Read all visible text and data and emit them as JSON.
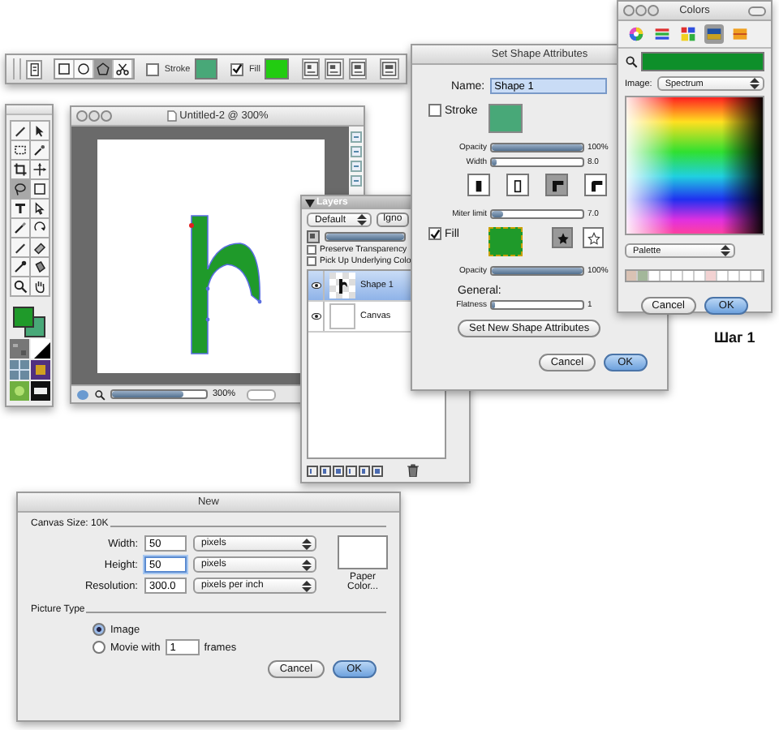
{
  "toolbar": {
    "tools": [
      {
        "kind": "rect",
        "selected": false
      },
      {
        "kind": "ellipse",
        "selected": false
      },
      {
        "kind": "polygon",
        "selected": true
      },
      {
        "kind": "scissors",
        "selected": false
      }
    ],
    "stroke": {
      "label": "Stroke",
      "checked": false
    },
    "fill": {
      "label": "Fill",
      "checked": true
    }
  },
  "tools_palette": {
    "tools": [
      {
        "kind": "pencil",
        "selected": false
      },
      {
        "kind": "arrow",
        "selected": false
      },
      {
        "kind": "marquee",
        "selected": false
      },
      {
        "kind": "wand",
        "selected": false
      },
      {
        "kind": "crop",
        "selected": false
      },
      {
        "kind": "move",
        "selected": false
      },
      {
        "kind": "lasso",
        "selected": true
      },
      {
        "kind": "rect",
        "selected": false
      },
      {
        "kind": "text",
        "selected": false
      },
      {
        "kind": "pointer",
        "selected": false
      },
      {
        "kind": "brush",
        "selected": false
      },
      {
        "kind": "rotate",
        "selected": false
      },
      {
        "kind": "pencil",
        "selected": false
      },
      {
        "kind": "eraser",
        "selected": false
      },
      {
        "kind": "dropper",
        "selected": false
      },
      {
        "kind": "bucket",
        "selected": false
      },
      {
        "kind": "zoom",
        "selected": false
      },
      {
        "kind": "hand",
        "selected": false
      }
    ]
  },
  "document_window": {
    "title": "Untitled-2 @ 300%",
    "zoom_slider": {
      "level": 0.75
    },
    "zoom": "300%"
  },
  "layers_panel": {
    "title": "Layers",
    "mode": "Default",
    "button": "Igno",
    "opacity": {
      "level": 1
    },
    "options": [
      {
        "label": "Preserve Transparency",
        "checked": false
      },
      {
        "label": "Pick Up Underlying Colo",
        "checked": false
      }
    ],
    "layers": [
      {
        "name": "Shape 1",
        "kind": "shape",
        "visible": true,
        "selected": true
      },
      {
        "name": "Canvas",
        "kind": "canvas",
        "visible": true,
        "selected": false
      }
    ]
  },
  "shape_dialog": {
    "title": "Set Shape Attributes",
    "name_label": "Name:",
    "name_value": "Shape 1",
    "stroke": {
      "label": "Stroke",
      "checked": false
    },
    "stroke_sliders": [
      {
        "label": "Opacity",
        "level": 1,
        "reading": "100%"
      },
      {
        "label": "Width",
        "level": 0.06,
        "reading": "8.0"
      }
    ],
    "joins": [
      {
        "selected": false
      },
      {
        "selected": false
      },
      {
        "selected": true
      },
      {
        "selected": false
      }
    ],
    "miter": {
      "label": "Miter limit",
      "level": 0.12,
      "reading": "7.0"
    },
    "fill": {
      "label": "Fill",
      "checked": true
    },
    "fill_styles": [
      {
        "selected": true
      },
      {
        "selected": false
      }
    ],
    "fill_opacity": {
      "label": "Opacity",
      "level": 1,
      "reading": "100%"
    },
    "general_label": "General:",
    "flatness": {
      "label": "Flatness",
      "level": 0.04,
      "reading": "1"
    },
    "set_button": "Set New Shape Attributes",
    "buttons": [
      {
        "label": "Cancel",
        "default": false
      },
      {
        "label": "OK",
        "default": true
      }
    ]
  },
  "colors_window": {
    "title": "Colors",
    "tabs": [
      {
        "kind": "wheel",
        "selected": false
      },
      {
        "kind": "sliders",
        "selected": false
      },
      {
        "kind": "palette",
        "selected": false
      },
      {
        "kind": "image",
        "selected": true
      },
      {
        "kind": "crayons",
        "selected": false
      }
    ],
    "image_label": "Image:",
    "image_value": "Spectrum",
    "palette_value": "Palette",
    "swatches": [
      {
        "color": "#d9c2b4"
      },
      {
        "color": "#a3b79a"
      },
      {
        "color": "#ffffff"
      },
      {
        "color": "#ffffff"
      },
      {
        "color": "#ffffff"
      },
      {
        "color": "#ffffff"
      },
      {
        "color": "#ffffff"
      },
      {
        "color": "#f2d2d2"
      },
      {
        "color": "#ffffff"
      },
      {
        "color": "#ffffff"
      },
      {
        "color": "#ffffff"
      },
      {
        "color": "#ffffff"
      }
    ],
    "buttons": [
      {
        "label": "Cancel",
        "default": false
      },
      {
        "label": "OK",
        "default": true
      }
    ]
  },
  "caption": "Шаг 1",
  "new_dialog": {
    "title": "New",
    "canvas_size": "Canvas Size: 10K",
    "fields": [
      {
        "label": "Width:",
        "value": "50",
        "unit": "pixels",
        "focused": false
      },
      {
        "label": "Height:",
        "value": "50",
        "unit": "pixels",
        "focused": true
      },
      {
        "label": "Resolution:",
        "value": "300.0",
        "unit": "pixels per inch",
        "focused": false
      }
    ],
    "paper_color": "Paper Color...",
    "picture_type": "Picture Type",
    "options": [
      {
        "kind": "image",
        "label": "Image",
        "selected": true
      },
      {
        "kind": "movie",
        "label": "Movie with",
        "value": "1",
        "suffix": "frames",
        "selected": false
      }
    ],
    "buttons": [
      {
        "label": "Cancel",
        "default": false
      },
      {
        "label": "OK",
        "default": true
      }
    ]
  }
}
